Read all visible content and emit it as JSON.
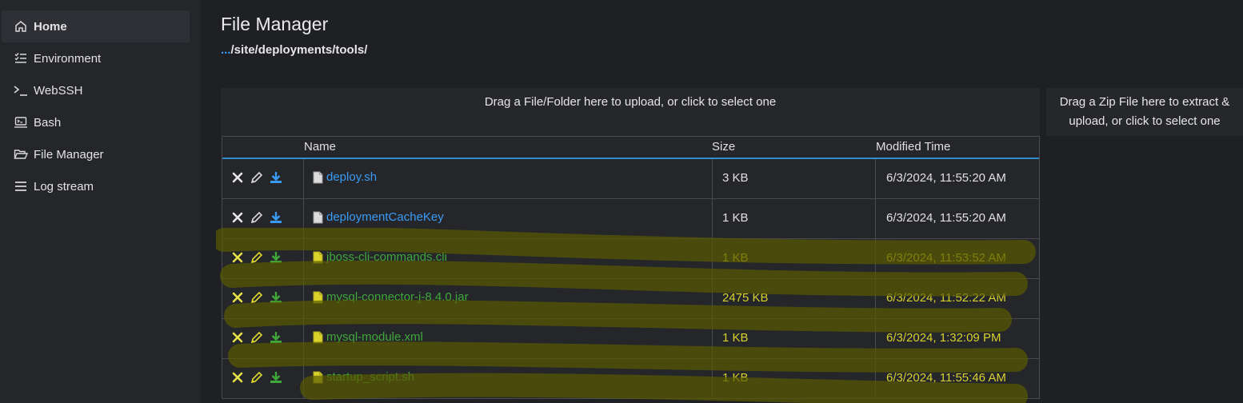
{
  "sidebar": {
    "items": [
      {
        "label": "Home",
        "icon": "home-icon",
        "active": true
      },
      {
        "label": "Environment",
        "icon": "checklist-icon"
      },
      {
        "label": "WebSSH",
        "icon": "terminal-icon"
      },
      {
        "label": "Bash",
        "icon": "laptop-console-icon"
      },
      {
        "label": "File Manager",
        "icon": "folder-open-icon"
      },
      {
        "label": "Log stream",
        "icon": "log-lines-icon"
      }
    ]
  },
  "main": {
    "title": "File Manager",
    "breadcrumb_up": "...",
    "breadcrumb_path": "/site/deployments/tools/",
    "dropzone_upload": "Drag a File/Folder here to upload, or click to select one",
    "dropzone_zip": "Drag a Zip File here to extract & upload, or click to select one"
  },
  "table": {
    "headers": {
      "name": "Name",
      "size": "Size",
      "modified": "Modified Time"
    },
    "rows": [
      {
        "name": "deploy.sh",
        "size": "3 KB",
        "modified": "6/3/2024, 11:55:20 AM"
      },
      {
        "name": "deploymentCacheKey",
        "size": "1 KB",
        "modified": "6/3/2024, 11:55:20 AM"
      },
      {
        "name": "jboss-cli-commands.cli",
        "size": "1 KB",
        "modified": "6/3/2024, 11:53:52 AM"
      },
      {
        "name": "mysql-connector-j-8.4.0.jar",
        "size": "2475 KB",
        "modified": "6/3/2024, 11:52:22 AM"
      },
      {
        "name": "mysql-module.xml",
        "size": "1 KB",
        "modified": "6/3/2024, 1:32:09 PM"
      },
      {
        "name": "startup_script.sh",
        "size": "1 KB",
        "modified": "6/3/2024, 11:55:46 AM"
      }
    ]
  },
  "colors": {
    "accent_blue": "#3a9bf5",
    "highlight_green": "#3fa83a",
    "highlight_yellow": "#d8d22a"
  }
}
